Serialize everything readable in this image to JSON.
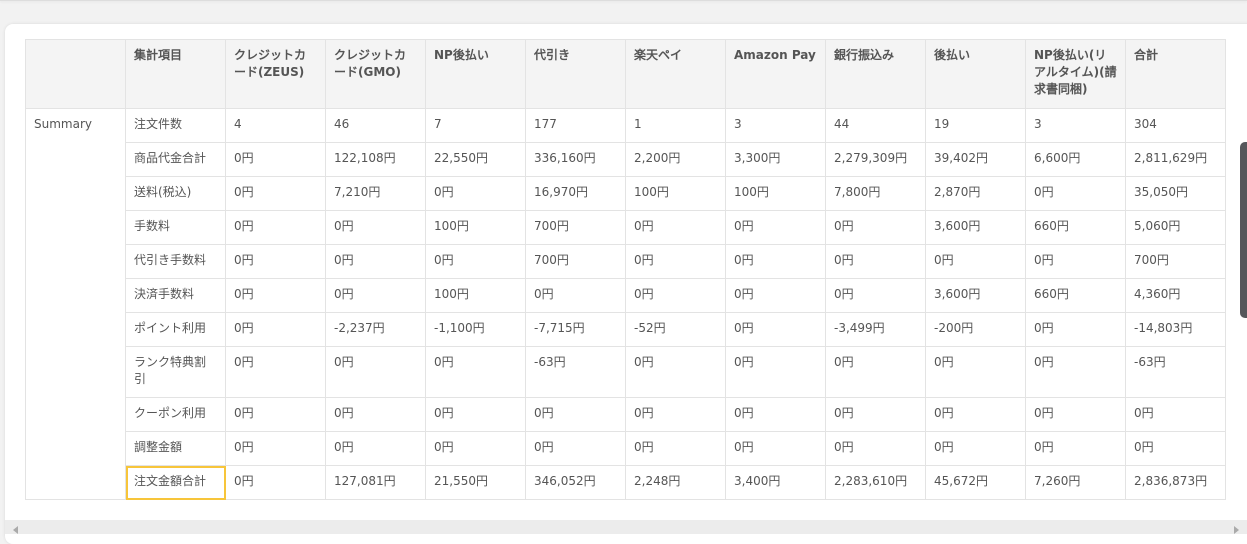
{
  "table": {
    "headers": [
      "",
      "集計項目",
      "クレジットカード(ZEUS)",
      "クレジットカード(GMO)",
      "NP後払い",
      "代引き",
      "楽天ペイ",
      "Amazon Pay",
      "銀行振込み",
      "後払い",
      "NP後払い(リアルタイム)(請求書同梱)",
      "合計"
    ],
    "group_label": "Summary",
    "rows": [
      {
        "label": "注文件数",
        "values": [
          "4",
          "46",
          "7",
          "177",
          "1",
          "3",
          "44",
          "19",
          "3",
          "304"
        ]
      },
      {
        "label": "商品代金合計",
        "values": [
          "0円",
          "122,108円",
          "22,550円",
          "336,160円",
          "2,200円",
          "3,300円",
          "2,279,309円",
          "39,402円",
          "6,600円",
          "2,811,629円"
        ]
      },
      {
        "label": "送料(税込)",
        "values": [
          "0円",
          "7,210円",
          "0円",
          "16,970円",
          "100円",
          "100円",
          "7,800円",
          "2,870円",
          "0円",
          "35,050円"
        ]
      },
      {
        "label": "手数料",
        "values": [
          "0円",
          "0円",
          "100円",
          "700円",
          "0円",
          "0円",
          "0円",
          "3,600円",
          "660円",
          "5,060円"
        ]
      },
      {
        "label": "代引き手数料",
        "values": [
          "0円",
          "0円",
          "0円",
          "700円",
          "0円",
          "0円",
          "0円",
          "0円",
          "0円",
          "700円"
        ]
      },
      {
        "label": "決済手数料",
        "values": [
          "0円",
          "0円",
          "100円",
          "0円",
          "0円",
          "0円",
          "0円",
          "3,600円",
          "660円",
          "4,360円"
        ]
      },
      {
        "label": "ポイント利用",
        "values": [
          "0円",
          "-2,237円",
          "-1,100円",
          "-7,715円",
          "-52円",
          "0円",
          "-3,499円",
          "-200円",
          "0円",
          "-14,803円"
        ]
      },
      {
        "label": "ランク特典割引",
        "values": [
          "0円",
          "0円",
          "0円",
          "-63円",
          "0円",
          "0円",
          "0円",
          "0円",
          "0円",
          "-63円"
        ]
      },
      {
        "label": "クーポン利用",
        "values": [
          "0円",
          "0円",
          "0円",
          "0円",
          "0円",
          "0円",
          "0円",
          "0円",
          "0円",
          "0円"
        ]
      },
      {
        "label": "調整金額",
        "values": [
          "0円",
          "0円",
          "0円",
          "0円",
          "0円",
          "0円",
          "0円",
          "0円",
          "0円",
          "0円"
        ]
      },
      {
        "label": "注文金額合計",
        "values": [
          "0円",
          "127,081円",
          "21,550円",
          "346,052円",
          "2,248円",
          "3,400円",
          "2,283,610円",
          "45,672円",
          "7,260円",
          "2,836,873円"
        ]
      }
    ]
  },
  "colors": {
    "highlight": "#f7c53a",
    "header_bg": "#f4f4f4"
  }
}
